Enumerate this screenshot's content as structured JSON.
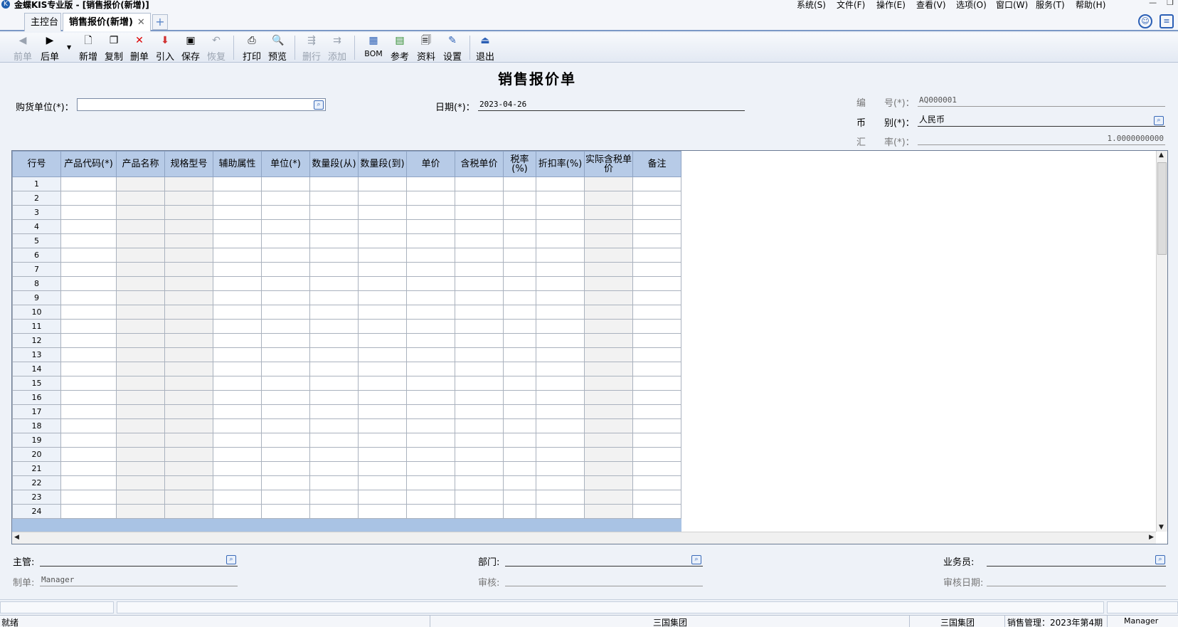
{
  "window": {
    "title": "金蝶KIS专业版 - [销售报价(新增)]"
  },
  "menu": [
    "系统(S)",
    "文件(F)",
    "操作(E)",
    "查看(V)",
    "选项(O)",
    "窗口(W)",
    "服务(T)",
    "帮助(H)"
  ],
  "tabs": [
    {
      "label": "主控台"
    },
    {
      "label": "销售报价(新增)"
    }
  ],
  "toolbar": {
    "prev": "前单",
    "next": "后单",
    "new": "新增",
    "copy": "复制",
    "delete": "删单",
    "import": "引入",
    "save": "保存",
    "restore": "恢复",
    "print": "打印",
    "preview": "预览",
    "delrow": "删行",
    "addrow": "添加",
    "bom": "BOM",
    "reference": "参考",
    "material": "资料",
    "settings": "设置",
    "exit": "退出"
  },
  "form": {
    "title": "销售报价单",
    "customer_label": "购货单位(*)：",
    "customer_value": "",
    "date_label": "日期(*)：",
    "date_value": "2023-04-26",
    "number_label": "编　　号(*)：",
    "number_value": "AQ000001",
    "currency_label": "币　　别(*)：",
    "currency_value": "人民币",
    "rate_label": "汇　　率(*)：",
    "rate_value": "1.0000000000"
  },
  "grid": {
    "headers": [
      "行号",
      "产品代码(*)",
      "产品名称",
      "规格型号",
      "辅助属性",
      "单位(*)",
      "数量段(从)",
      "数量段(到)",
      "单价",
      "含税单价",
      "税率(%)",
      "折扣率(%)",
      "实际含税单价",
      "备注"
    ],
    "rows": [
      "1",
      "2",
      "3",
      "4",
      "5",
      "6",
      "7",
      "8",
      "9",
      "10",
      "11",
      "12",
      "13",
      "14",
      "15",
      "16",
      "17",
      "18",
      "19",
      "20",
      "21",
      "22",
      "23",
      "24"
    ]
  },
  "footer": {
    "manager_label": "主管:",
    "dept_label": "部门:",
    "salesman_label": "业务员:",
    "maker_label": "制单:",
    "maker_value": "Manager",
    "auditor_label": "审核:",
    "audit_date_label": "审核日期:"
  },
  "status": {
    "ready": "就绪",
    "company1": "三国集团",
    "company2": "三国集团",
    "period": "销售管理：2023年第4期",
    "user": "Manager"
  }
}
